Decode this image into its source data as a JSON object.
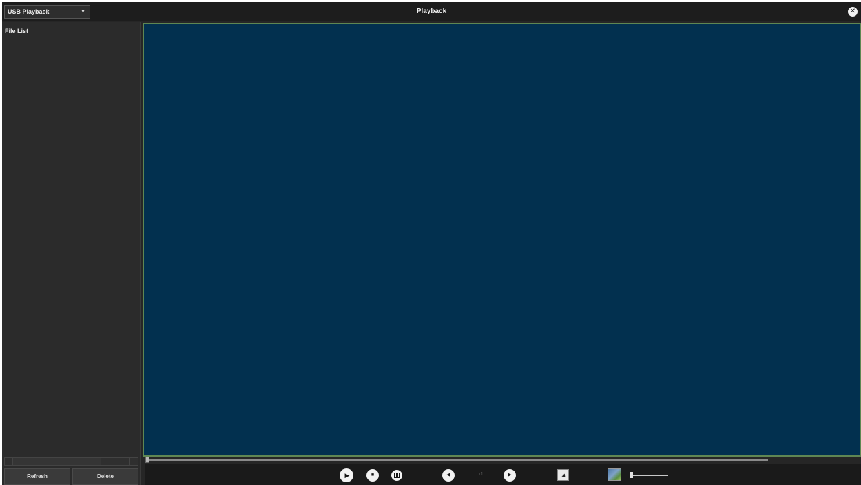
{
  "titlebar": {
    "source_select": "USB Playback",
    "dropdown_glyph": "▾",
    "title": "Playback",
    "close_glyph": "✕"
  },
  "left_panel": {
    "file_list_header": "File List",
    "buttons": {
      "refresh": "Refresh",
      "delete": "Delete"
    }
  },
  "seek": {
    "progress": 0
  },
  "controls": {
    "play_glyph": "▶",
    "stop_glyph": "■",
    "slow_glyph": "◀",
    "fast_glyph": "▶",
    "speed_text": "x1",
    "volume_level": 0
  },
  "icons": [
    "dropdown-arrow-icon",
    "close-icon",
    "play-icon",
    "stop-icon",
    "frame-step-icon",
    "slow-play-icon",
    "fast-forward-icon",
    "snapshot-icon",
    "audio-icon"
  ],
  "colors": {
    "video_background": "#02304f",
    "video_border": "#5f8753",
    "panel_background": "#2b2b2b",
    "control_bar": "#1a1a1a"
  }
}
